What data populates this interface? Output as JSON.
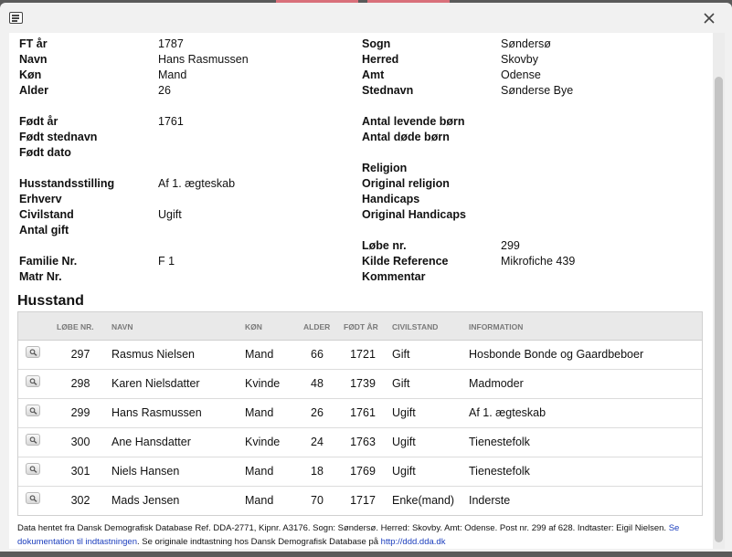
{
  "record": {
    "left": [
      {
        "label": "FT år",
        "value": "1787"
      },
      {
        "label": "Navn",
        "value": "Hans Rasmussen"
      },
      {
        "label": "Køn",
        "value": "Mand"
      },
      {
        "label": "Alder",
        "value": "26"
      },
      {
        "label": "Født år",
        "value": "1761"
      },
      {
        "label": "Født stednavn",
        "value": ""
      },
      {
        "label": "Født dato",
        "value": ""
      },
      {
        "label": "Husstandsstilling",
        "value": "Af 1. ægteskab"
      },
      {
        "label": "Erhverv",
        "value": ""
      },
      {
        "label": "Civilstand",
        "value": "Ugift"
      },
      {
        "label": "Antal gift",
        "value": ""
      },
      {
        "label": "Familie Nr.",
        "value": "F 1"
      },
      {
        "label": "Matr Nr.",
        "value": ""
      }
    ],
    "right": [
      {
        "label": "Sogn",
        "value": "Søndersø"
      },
      {
        "label": "Herred",
        "value": "Skovby"
      },
      {
        "label": "Amt",
        "value": "Odense"
      },
      {
        "label": "Stednavn",
        "value": "Sønderse Bye"
      },
      {
        "label": "Antal levende børn",
        "value": ""
      },
      {
        "label": "Antal døde børn",
        "value": ""
      },
      {
        "label": "Religion",
        "value": ""
      },
      {
        "label": "Original religion",
        "value": ""
      },
      {
        "label": "Handicaps",
        "value": ""
      },
      {
        "label": "Original Handicaps",
        "value": ""
      },
      {
        "label": "Løbe nr.",
        "value": "299"
      },
      {
        "label": "Kilde Reference",
        "value": "Mikrofiche 439"
      },
      {
        "label": "Kommentar",
        "value": ""
      }
    ]
  },
  "household": {
    "title": "Husstand",
    "columns": [
      "LØBE NR.",
      "NAVN",
      "KØN",
      "ALDER",
      "FØDT ÅR",
      "CIVILSTAND",
      "INFORMATION"
    ],
    "rows": [
      [
        "297",
        "Rasmus Nielsen",
        "Mand",
        "66",
        "1721",
        "Gift",
        "Hosbonde Bonde og Gaardbeboer"
      ],
      [
        "298",
        "Karen Nielsdatter",
        "Kvinde",
        "48",
        "1739",
        "Gift",
        "Madmoder"
      ],
      [
        "299",
        "Hans Rasmussen",
        "Mand",
        "26",
        "1761",
        "Ugift",
        "Af 1. ægteskab"
      ],
      [
        "300",
        "Ane Hansdatter",
        "Kvinde",
        "24",
        "1763",
        "Ugift",
        "Tienestefolk"
      ],
      [
        "301",
        "Niels Hansen",
        "Mand",
        "18",
        "1769",
        "Ugift",
        "Tienestefolk"
      ],
      [
        "302",
        "Mads Jensen",
        "Mand",
        "70",
        "1717",
        "Enke(mand)",
        "Inderste"
      ]
    ]
  },
  "footer": {
    "text": "Data hentet fra Dansk Demografisk Database Ref. DDA-2771, Kipnr. A3176. Sogn: Søndersø. Herred: Skovby. Amt: Odense. Post nr. 299 af 628. Indtaster: Eigil Nielsen.",
    "link1": "Se dokumentation til indtastningen",
    "mid": "Se originale indtastning hos Dansk Demografisk Database på",
    "link2": "http://ddd.dda.dk"
  }
}
